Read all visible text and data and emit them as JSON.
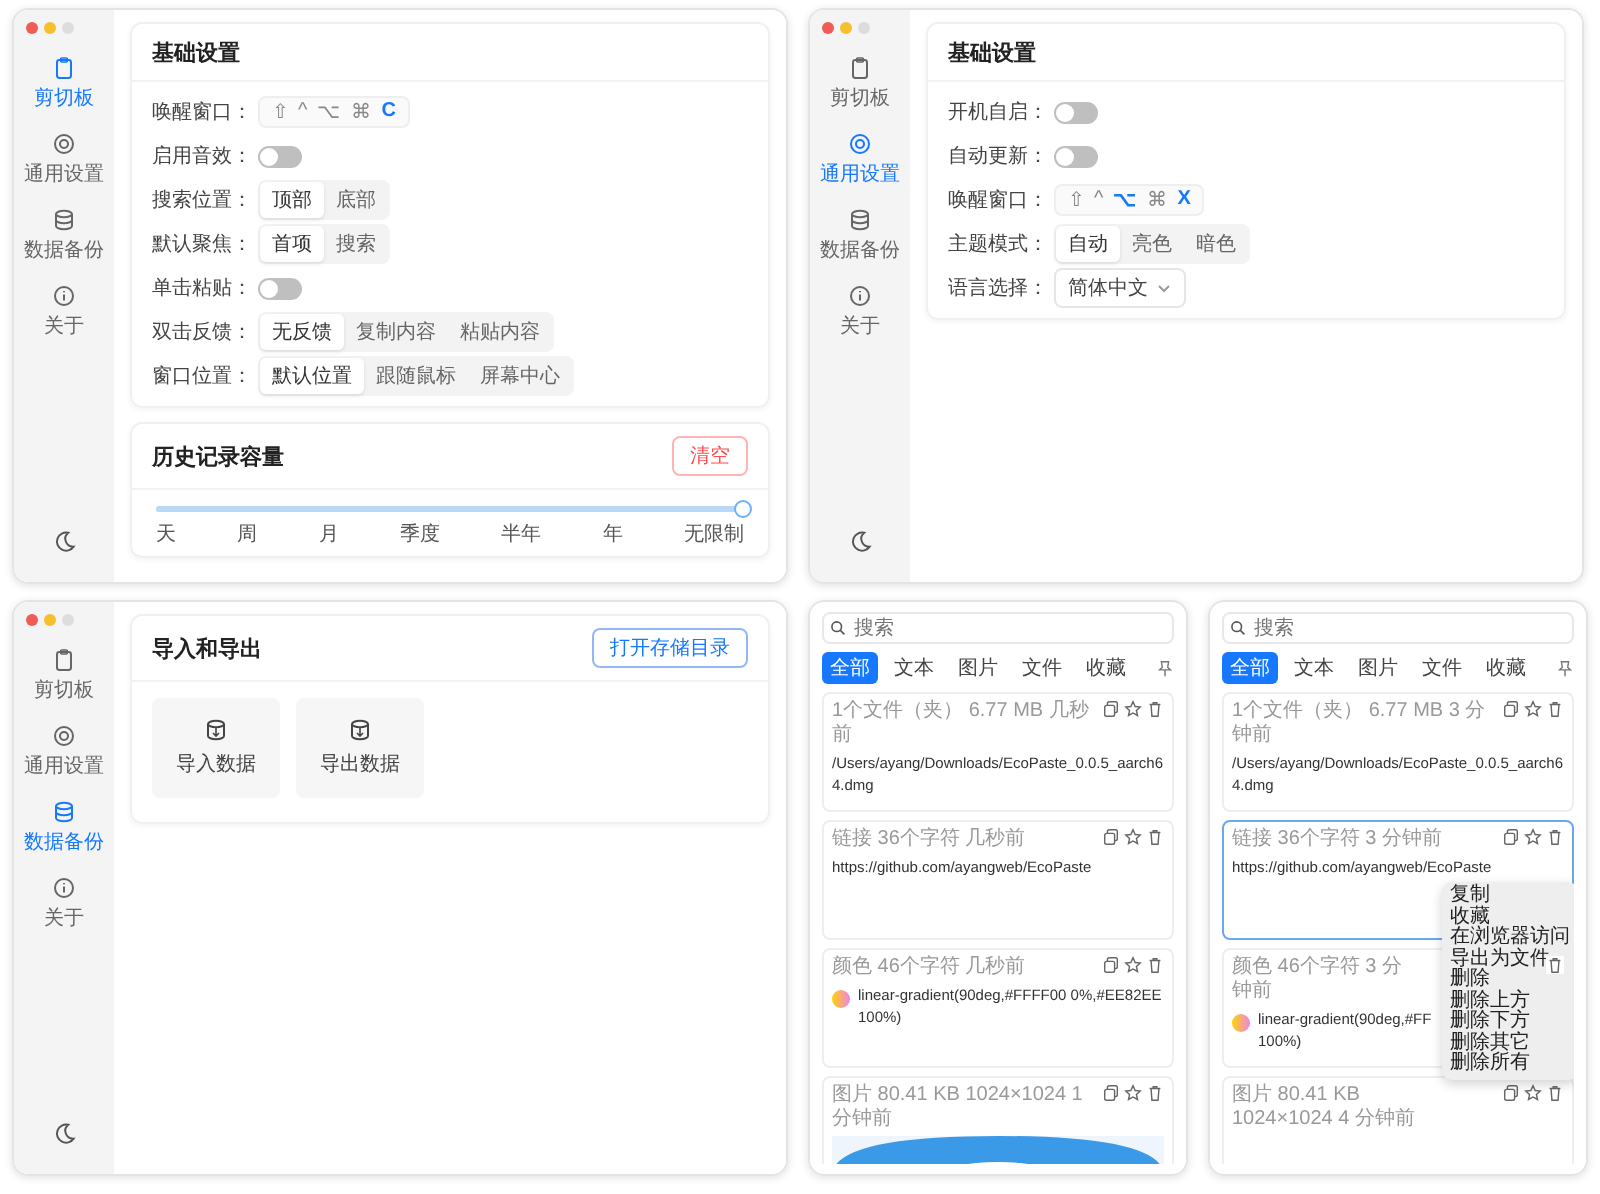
{
  "settings_windows": [
    {
      "sidebar": [
        {
          "label": "剪切板",
          "selected": true
        },
        {
          "label": "通用设置",
          "selected": false
        },
        {
          "label": "数据备份",
          "selected": false
        },
        {
          "label": "关于",
          "selected": false
        }
      ],
      "sections": [
        {
          "title": "基础设置",
          "rows": [
            {
              "kind": "shortcut",
              "label": "唤醒窗口：",
              "keys": [
                {
                  "key": "⇧",
                  "active": false
                },
                {
                  "key": "^",
                  "active": false
                },
                {
                  "key": "⌥",
                  "active": false
                },
                {
                  "key": "⌘",
                  "active": false
                },
                {
                  "key": "C",
                  "active": true
                }
              ]
            },
            {
              "kind": "switch",
              "label": "启用音效：",
              "on": false
            },
            {
              "kind": "segmented",
              "label": "搜索位置：",
              "options": [
                {
                  "label": "顶部",
                  "selected": true
                },
                {
                  "label": "底部",
                  "selected": false
                }
              ]
            },
            {
              "kind": "segmented",
              "label": "默认聚焦：",
              "options": [
                {
                  "label": "首项",
                  "selected": true
                },
                {
                  "label": "搜索",
                  "selected": false
                }
              ]
            },
            {
              "kind": "switch",
              "label": "单击粘贴：",
              "on": false
            },
            {
              "kind": "segmented",
              "label": "双击反馈：",
              "options": [
                {
                  "label": "无反馈",
                  "selected": true
                },
                {
                  "label": "复制内容",
                  "selected": false
                },
                {
                  "label": "粘贴内容",
                  "selected": false
                }
              ]
            },
            {
              "kind": "segmented",
              "label": "窗口位置：",
              "options": [
                {
                  "label": "默认位置",
                  "selected": true
                },
                {
                  "label": "跟随鼠标",
                  "selected": false
                },
                {
                  "label": "屏幕中心",
                  "selected": false
                }
              ]
            }
          ]
        },
        {
          "title": "历史记录容量",
          "action": "清空",
          "slider": {
            "level": 1,
            "ticks": [
              "天",
              "周",
              "月",
              "季度",
              "半年",
              "年",
              "无限制"
            ]
          }
        }
      ]
    },
    {
      "sidebar": [
        {
          "label": "剪切板",
          "selected": false
        },
        {
          "label": "通用设置",
          "selected": true
        },
        {
          "label": "数据备份",
          "selected": false
        },
        {
          "label": "关于",
          "selected": false
        }
      ],
      "sections": [
        {
          "title": "基础设置",
          "rows": [
            {
              "kind": "switch",
              "label": "开机自启：",
              "on": false
            },
            {
              "kind": "switch",
              "label": "自动更新：",
              "on": false
            },
            {
              "kind": "shortcut",
              "label": "唤醒窗口：",
              "keys": [
                {
                  "key": "⇧",
                  "active": false
                },
                {
                  "key": "^",
                  "active": false
                },
                {
                  "key": "⌥",
                  "active": true
                },
                {
                  "key": "⌘",
                  "active": false
                },
                {
                  "key": "X",
                  "active": true
                }
              ]
            },
            {
              "kind": "segmented",
              "label": "主题模式：",
              "options": [
                {
                  "label": "自动",
                  "selected": true
                },
                {
                  "label": "亮色",
                  "selected": false
                },
                {
                  "label": "暗色",
                  "selected": false
                }
              ]
            },
            {
              "kind": "select",
              "label": "语言选择：",
              "value": "简体中文"
            }
          ]
        }
      ]
    },
    {
      "sidebar": [
        {
          "label": "剪切板",
          "selected": false
        },
        {
          "label": "通用设置",
          "selected": false
        },
        {
          "label": "数据备份",
          "selected": true
        },
        {
          "label": "关于",
          "selected": false
        }
      ],
      "sections": [
        {
          "title": "导入和导出",
          "action": "打开存储目录",
          "cards": [
            {
              "label": "导入数据"
            },
            {
              "label": "导出数据"
            }
          ]
        }
      ]
    }
  ],
  "clipboard_windows": [
    {
      "search": {
        "placeholder": "搜索"
      },
      "tabs": [
        {
          "label": "全部",
          "selected": true
        },
        {
          "label": "文本",
          "selected": false
        },
        {
          "label": "图片",
          "selected": false
        },
        {
          "label": "文件",
          "selected": false
        },
        {
          "label": "收藏",
          "selected": false
        }
      ],
      "items": [
        {
          "kind": "file",
          "meta": "1个文件（夹） 6.77 MB 几秒前",
          "lines": [
            "/Users/ayang/Downloads/EcoPaste_0.0.5_aarch6",
            "4.dmg"
          ],
          "selected": false
        },
        {
          "kind": "link",
          "meta": "链接 36个字符 几秒前",
          "lines": [
            "https://github.com/ayangweb/EcoPaste"
          ],
          "selected": false
        },
        {
          "kind": "color",
          "meta": "颜色 46个字符 几秒前",
          "lines": [
            "linear-gradient(90deg,#FFFF00 0%,#EE82EE",
            "100%)"
          ],
          "selected": false
        },
        {
          "meta": "图片 80.41 KB 1024×1024 1 分钟前",
          "selected": false
        }
      ]
    },
    {
      "search": {
        "placeholder": "搜索"
      },
      "tabs": [
        {
          "label": "全部",
          "selected": true
        },
        {
          "label": "文本",
          "selected": false
        },
        {
          "label": "图片",
          "selected": false
        },
        {
          "label": "文件",
          "selected": false
        },
        {
          "label": "收藏",
          "selected": false
        }
      ],
      "items": [
        {
          "kind": "file",
          "meta": "1个文件（夹） 6.77 MB 3 分钟前",
          "lines": [
            "/Users/ayang/Downloads/EcoPaste_0.0.5_aarch6",
            "4.dmg"
          ],
          "selected": false
        },
        {
          "kind": "link",
          "meta": "链接 36个字符 3 分钟前",
          "lines": [
            "https://github.com/ayangweb/EcoPaste"
          ],
          "selected": true
        },
        {
          "kind": "color",
          "meta": "颜色 46个字符 3 分钟前",
          "lines": [
            "linear-gradient(90deg,#FF",
            "100%)"
          ],
          "selected": false
        },
        {
          "meta": "图片 80.41 KB 1024×1024 4 分钟前",
          "selected": false
        }
      ],
      "menu": [
        "复制",
        "收藏",
        "在浏览器访问",
        "导出为文件",
        "删除",
        "删除上方",
        "删除下方",
        "删除其它",
        "删除所有"
      ]
    }
  ]
}
